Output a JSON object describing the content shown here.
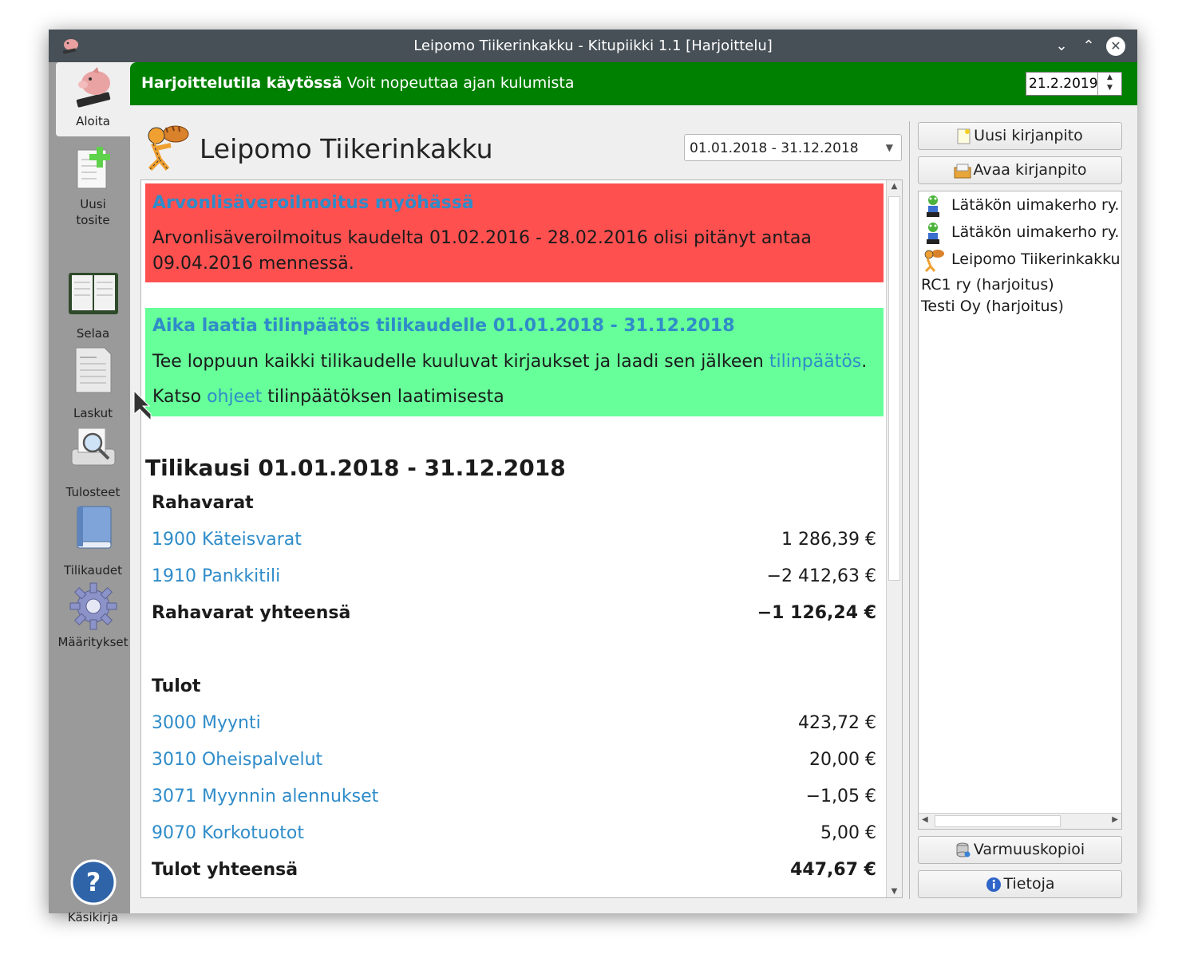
{
  "window": {
    "title": "Leipomo Tiikerinkakku - Kitupiikki 1.1 [Harjoittelu]"
  },
  "sidebar": {
    "items": [
      {
        "label": "Aloita",
        "icon": "piggy-bank-icon",
        "active": true
      },
      {
        "label": "Uusi\ntosite",
        "icon": "new-document-icon"
      },
      {
        "label": "Selaa",
        "icon": "ledger-book-icon"
      },
      {
        "label": "Laskut",
        "icon": "invoice-icon"
      },
      {
        "label": "Tulosteet",
        "icon": "print-preview-icon"
      },
      {
        "label": "Tilikaudet",
        "icon": "book-icon"
      },
      {
        "label": "Määritykset",
        "icon": "gear-icon"
      },
      {
        "label": "Käsikirja",
        "icon": "help-icon"
      }
    ]
  },
  "banner": {
    "bold": "Harjoittelutila käytössä",
    "text": " Voit nopeuttaa ajan kulumista",
    "date": "21.2.2019",
    "color": "#008000"
  },
  "company": {
    "name": "Leipomo Tiikerinkakku"
  },
  "period": {
    "selected": "01.01.2018 - 31.12.2018"
  },
  "alerts": {
    "red": {
      "title": "Arvonlisäveroilmoitus myöhässä",
      "line1": "Arvonlisäveroilmoitus kaudelta 01.02.2016 - 28.02.2016 olisi pitänyt antaa",
      "line2": "09.04.2016 mennessä.",
      "color": "#ff5050"
    },
    "green": {
      "title": "Aika laatia tilinpäätös tilikaudelle 01.01.2018 - 31.12.2018",
      "line1_pre": "Tee loppuun kaikki tilikaudelle kuuluvat kirjaukset ja laadi sen jälkeen ",
      "line1_link": "tilinpäätös",
      "line1_post": ".",
      "line2_pre": "Katso ",
      "line2_link": "ohjeet",
      "line2_post": " tilinpäätöksen laatimisesta",
      "color": "#66ff99"
    }
  },
  "summary": {
    "title": "Tilikausi 01.01.2018 - 31.12.2018",
    "cash": {
      "heading": "Rahavarat",
      "accounts": [
        {
          "label": "1900 Käteisvarat",
          "amount": "1 286,39 €"
        },
        {
          "label": "1910 Pankkitili",
          "amount": "−2 412,63 €"
        }
      ],
      "total_label": "Rahavarat yhteensä",
      "total": "−1 126,24 €"
    },
    "income": {
      "heading": "Tulot",
      "accounts": [
        {
          "label": "3000 Myynti",
          "amount": "423,72 €"
        },
        {
          "label": "3010 Oheispalvelut",
          "amount": "20,00 €"
        },
        {
          "label": "3071 Myynnin alennukset",
          "amount": "−1,05 €"
        },
        {
          "label": "9070 Korkotuotot",
          "amount": "5,00 €"
        }
      ],
      "total_label": "Tulot yhteensä",
      "total": "447,67 €"
    }
  },
  "right_panel": {
    "new_button": "Uusi kirjanpito",
    "open_button": "Avaa kirjanpito",
    "books": [
      {
        "name": "Lätäkön uimakerho ry. (l",
        "icon": "frog-icon"
      },
      {
        "name": "Lätäkön uimakerho ry. (l",
        "icon": "frog-icon"
      },
      {
        "name": "Leipomo Tiikerinkakku (",
        "icon": "tiger-icon"
      },
      {
        "name": "RC1 ry (harjoitus)"
      },
      {
        "name": "Testi Oy (harjoitus)"
      }
    ],
    "backup_button": "Varmuuskopioi",
    "info_button": "Tietoja"
  }
}
